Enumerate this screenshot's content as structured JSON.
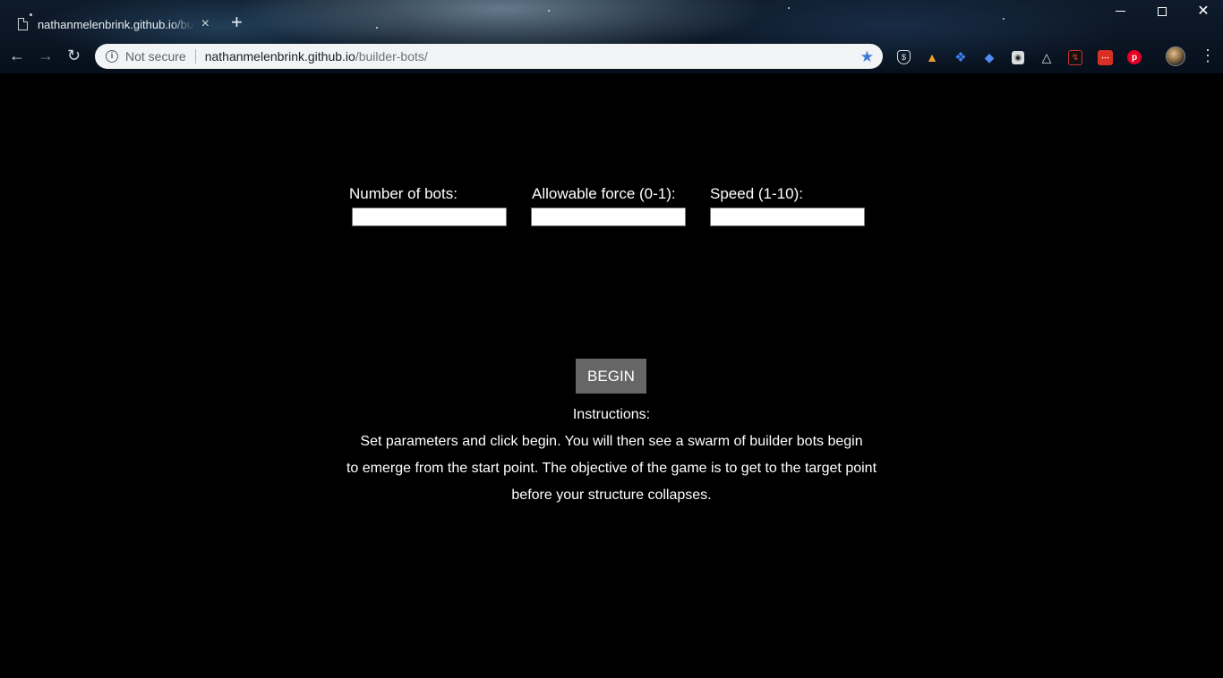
{
  "browser": {
    "tab_title": "nathanmelenbrink.github.io/builder-bots/",
    "tab_close": "×",
    "new_tab": "+",
    "security_label": "Not secure",
    "url_host": "nathanmelenbrink.github.io",
    "url_path": "/builder-bots/",
    "window_close": "✕",
    "menu": "⋮"
  },
  "form": {
    "bots_label": "Number of bots:",
    "force_label": "Allowable force (0-1):",
    "speed_label": "Speed (1-10):",
    "bots_value": "",
    "force_value": "",
    "speed_value": ""
  },
  "begin_label": "BEGIN",
  "instructions": {
    "title": "Instructions:",
    "lines": [
      "Set parameters and click begin. You will then see a swarm of builder bots begin",
      "to emerge from the start point. The objective of the game is to get to the target point",
      "before your structure collapses."
    ]
  },
  "colors": {
    "background": "#000000",
    "button": "#666666",
    "bookmark_star": "#3a7bd5"
  }
}
